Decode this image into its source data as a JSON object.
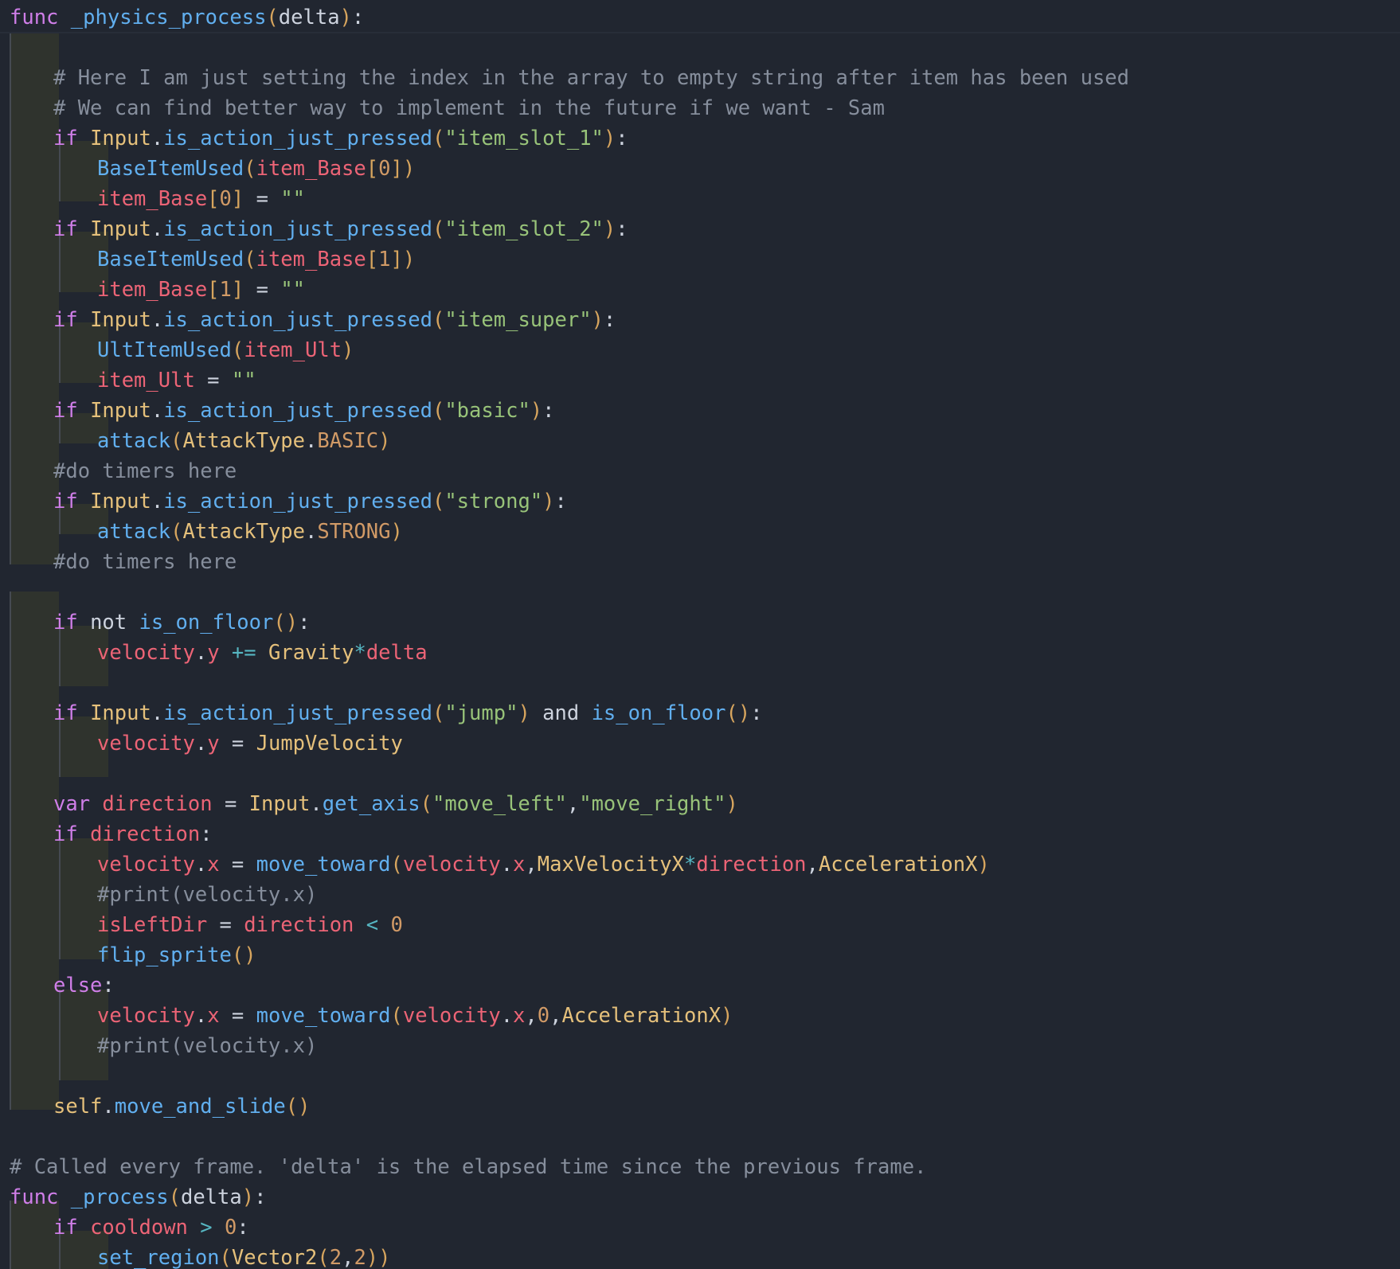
{
  "editor": {
    "language": "GDScript",
    "theme_colors": {
      "background": "#212630",
      "keyword": "#cf7ee8",
      "function": "#61afef",
      "class": "#e5c07b",
      "variable": "#ec6476",
      "string": "#98c379",
      "number": "#d19a66",
      "comment": "#868e9c",
      "indent_guide": "#2f332d"
    },
    "lines": [
      [
        [
          "kw",
          "func"
        ],
        [
          "tx",
          " "
        ],
        [
          "fn",
          "_physics_process"
        ],
        [
          "pc",
          "("
        ],
        [
          "tx",
          "delta"
        ],
        [
          "pc",
          ")"
        ],
        [
          "tx",
          ":"
        ]
      ],
      [],
      [
        [
          "cm",
          "# Here I am just setting the index in the array to empty string after item has been used"
        ]
      ],
      [
        [
          "cm",
          "# We can find better way to implement in the future if we want - Sam"
        ]
      ],
      [
        [
          "kw",
          "if"
        ],
        [
          "tx",
          " "
        ],
        [
          "cl",
          "Input"
        ],
        [
          "tx",
          "."
        ],
        [
          "fn",
          "is_action_just_pressed"
        ],
        [
          "pc",
          "("
        ],
        [
          "st",
          "\"item_slot_1\""
        ],
        [
          "pc",
          ")"
        ],
        [
          "tx",
          ":"
        ]
      ],
      [
        [
          "fn",
          "BaseItemUsed"
        ],
        [
          "pc",
          "("
        ],
        [
          "va",
          "item_Base"
        ],
        [
          "pc",
          "["
        ],
        [
          "nu",
          "0"
        ],
        [
          "pc",
          "])"
        ]
      ],
      [
        [
          "va",
          "item_Base"
        ],
        [
          "pc",
          "["
        ],
        [
          "nu",
          "0"
        ],
        [
          "pc",
          "]"
        ],
        [
          "tx",
          " = "
        ],
        [
          "st",
          "\"\""
        ]
      ],
      [
        [
          "kw",
          "if"
        ],
        [
          "tx",
          " "
        ],
        [
          "cl",
          "Input"
        ],
        [
          "tx",
          "."
        ],
        [
          "fn",
          "is_action_just_pressed"
        ],
        [
          "pc",
          "("
        ],
        [
          "st",
          "\"item_slot_2\""
        ],
        [
          "pc",
          ")"
        ],
        [
          "tx",
          ":"
        ]
      ],
      [
        [
          "fn",
          "BaseItemUsed"
        ],
        [
          "pc",
          "("
        ],
        [
          "va",
          "item_Base"
        ],
        [
          "pc",
          "["
        ],
        [
          "nu",
          "1"
        ],
        [
          "pc",
          "])"
        ]
      ],
      [
        [
          "va",
          "item_Base"
        ],
        [
          "pc",
          "["
        ],
        [
          "nu",
          "1"
        ],
        [
          "pc",
          "]"
        ],
        [
          "tx",
          " = "
        ],
        [
          "st",
          "\"\""
        ]
      ],
      [
        [
          "kw",
          "if"
        ],
        [
          "tx",
          " "
        ],
        [
          "cl",
          "Input"
        ],
        [
          "tx",
          "."
        ],
        [
          "fn",
          "is_action_just_pressed"
        ],
        [
          "pc",
          "("
        ],
        [
          "st",
          "\"item_super\""
        ],
        [
          "pc",
          ")"
        ],
        [
          "tx",
          ":"
        ]
      ],
      [
        [
          "fn",
          "UltItemUsed"
        ],
        [
          "pc",
          "("
        ],
        [
          "va",
          "item_Ult"
        ],
        [
          "pc",
          ")"
        ]
      ],
      [
        [
          "va",
          "item_Ult"
        ],
        [
          "tx",
          " = "
        ],
        [
          "st",
          "\"\""
        ]
      ],
      [
        [
          "kw",
          "if"
        ],
        [
          "tx",
          " "
        ],
        [
          "cl",
          "Input"
        ],
        [
          "tx",
          "."
        ],
        [
          "fn",
          "is_action_just_pressed"
        ],
        [
          "pc",
          "("
        ],
        [
          "st",
          "\"basic\""
        ],
        [
          "pc",
          ")"
        ],
        [
          "tx",
          ":"
        ]
      ],
      [
        [
          "fn",
          "attack"
        ],
        [
          "pc",
          "("
        ],
        [
          "cl",
          "AttackType"
        ],
        [
          "tx",
          "."
        ],
        [
          "nu",
          "BASIC"
        ],
        [
          "pc",
          ")"
        ]
      ],
      [
        [
          "cm",
          "#do timers here"
        ]
      ],
      [
        [
          "kw",
          "if"
        ],
        [
          "tx",
          " "
        ],
        [
          "cl",
          "Input"
        ],
        [
          "tx",
          "."
        ],
        [
          "fn",
          "is_action_just_pressed"
        ],
        [
          "pc",
          "("
        ],
        [
          "st",
          "\"strong\""
        ],
        [
          "pc",
          ")"
        ],
        [
          "tx",
          ":"
        ]
      ],
      [
        [
          "fn",
          "attack"
        ],
        [
          "pc",
          "("
        ],
        [
          "cl",
          "AttackType"
        ],
        [
          "tx",
          "."
        ],
        [
          "nu",
          "STRONG"
        ],
        [
          "pc",
          ")"
        ]
      ],
      [
        [
          "cm",
          "#do timers here"
        ]
      ],
      [],
      [
        [
          "kw",
          "if"
        ],
        [
          "tx",
          " not "
        ],
        [
          "fn",
          "is_on_floor"
        ],
        [
          "pc",
          "()"
        ],
        [
          "tx",
          ":"
        ]
      ],
      [
        [
          "va",
          "velocity"
        ],
        [
          "tx",
          "."
        ],
        [
          "va",
          "y"
        ],
        [
          "tx",
          " "
        ],
        [
          "op",
          "+="
        ],
        [
          "tx",
          " "
        ],
        [
          "cl",
          "Gravity"
        ],
        [
          "op",
          "*"
        ],
        [
          "va",
          "delta"
        ]
      ],
      [],
      [
        [
          "kw",
          "if"
        ],
        [
          "tx",
          " "
        ],
        [
          "cl",
          "Input"
        ],
        [
          "tx",
          "."
        ],
        [
          "fn",
          "is_action_just_pressed"
        ],
        [
          "pc",
          "("
        ],
        [
          "st",
          "\"jump\""
        ],
        [
          "pc",
          ")"
        ],
        [
          "tx",
          " and "
        ],
        [
          "fn",
          "is_on_floor"
        ],
        [
          "pc",
          "()"
        ],
        [
          "tx",
          ":"
        ]
      ],
      [
        [
          "va",
          "velocity"
        ],
        [
          "tx",
          "."
        ],
        [
          "va",
          "y"
        ],
        [
          "tx",
          " = "
        ],
        [
          "cl",
          "JumpVelocity"
        ]
      ],
      [],
      [
        [
          "kw",
          "var"
        ],
        [
          "tx",
          " "
        ],
        [
          "va",
          "direction"
        ],
        [
          "tx",
          " = "
        ],
        [
          "cl",
          "Input"
        ],
        [
          "tx",
          "."
        ],
        [
          "fn",
          "get_axis"
        ],
        [
          "pc",
          "("
        ],
        [
          "st",
          "\"move_left\""
        ],
        [
          "tx",
          ","
        ],
        [
          "st",
          "\"move_right\""
        ],
        [
          "pc",
          ")"
        ]
      ],
      [
        [
          "kw",
          "if"
        ],
        [
          "tx",
          " "
        ],
        [
          "va",
          "direction"
        ],
        [
          "tx",
          ":"
        ]
      ],
      [
        [
          "va",
          "velocity"
        ],
        [
          "tx",
          "."
        ],
        [
          "va",
          "x"
        ],
        [
          "tx",
          " = "
        ],
        [
          "fn",
          "move_toward"
        ],
        [
          "pc",
          "("
        ],
        [
          "va",
          "velocity"
        ],
        [
          "tx",
          "."
        ],
        [
          "va",
          "x"
        ],
        [
          "tx",
          ","
        ],
        [
          "cl",
          "MaxVelocityX"
        ],
        [
          "op",
          "*"
        ],
        [
          "va",
          "direction"
        ],
        [
          "tx",
          ","
        ],
        [
          "cl",
          "AccelerationX"
        ],
        [
          "pc",
          ")"
        ]
      ],
      [
        [
          "cm",
          "#print(velocity.x)"
        ]
      ],
      [
        [
          "va",
          "isLeftDir"
        ],
        [
          "tx",
          " = "
        ],
        [
          "va",
          "direction"
        ],
        [
          "tx",
          " "
        ],
        [
          "op",
          "<"
        ],
        [
          "tx",
          " "
        ],
        [
          "nu",
          "0"
        ]
      ],
      [
        [
          "fn",
          "flip_sprite"
        ],
        [
          "pc",
          "()"
        ]
      ],
      [
        [
          "kw",
          "else"
        ],
        [
          "tx",
          ":"
        ]
      ],
      [
        [
          "va",
          "velocity"
        ],
        [
          "tx",
          "."
        ],
        [
          "va",
          "x"
        ],
        [
          "tx",
          " = "
        ],
        [
          "fn",
          "move_toward"
        ],
        [
          "pc",
          "("
        ],
        [
          "va",
          "velocity"
        ],
        [
          "tx",
          "."
        ],
        [
          "va",
          "x"
        ],
        [
          "tx",
          ","
        ],
        [
          "nu",
          "0"
        ],
        [
          "tx",
          ","
        ],
        [
          "cl",
          "AccelerationX"
        ],
        [
          "pc",
          ")"
        ]
      ],
      [
        [
          "cm",
          "#print(velocity.x)"
        ]
      ],
      [],
      [
        [
          "cl",
          "self"
        ],
        [
          "tx",
          "."
        ],
        [
          "fn",
          "move_and_slide"
        ],
        [
          "pc",
          "()"
        ]
      ],
      [],
      [
        [
          "cm",
          "# Called every frame. 'delta' is the elapsed time since the previous frame."
        ]
      ],
      [
        [
          "kw",
          "func"
        ],
        [
          "tx",
          " "
        ],
        [
          "fn",
          "_process"
        ],
        [
          "pc",
          "("
        ],
        [
          "tx",
          "delta"
        ],
        [
          "pc",
          ")"
        ],
        [
          "tx",
          ":"
        ]
      ],
      [
        [
          "kw",
          "if"
        ],
        [
          "tx",
          " "
        ],
        [
          "va",
          "cooldown"
        ],
        [
          "tx",
          " "
        ],
        [
          "op",
          ">"
        ],
        [
          "tx",
          " "
        ],
        [
          "nu",
          "0"
        ],
        [
          "tx",
          ":"
        ]
      ],
      [
        [
          "fn",
          "set_region"
        ],
        [
          "pc",
          "("
        ],
        [
          "cl",
          "Vector2"
        ],
        [
          "pc",
          "("
        ],
        [
          "nu",
          "2"
        ],
        [
          "tx",
          ","
        ],
        [
          "nu",
          "2"
        ],
        [
          "pc",
          "))"
        ]
      ]
    ]
  }
}
